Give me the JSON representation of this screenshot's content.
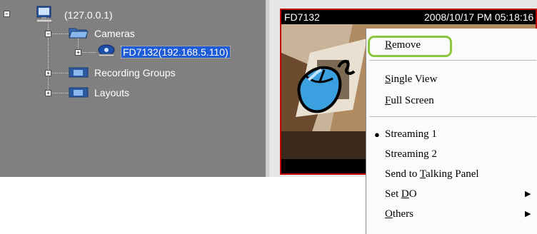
{
  "tree": {
    "root_label": "(127.0.0.1)",
    "cameras_label": "Cameras",
    "camera_item_label": "FD7132(192.168.5.110)",
    "recording_groups_label": "Recording Groups",
    "layouts_label": "Layouts"
  },
  "video": {
    "camera_name": "FD7132",
    "timestamp": "2008/10/17 PM 05:18:16"
  },
  "context_menu": {
    "items": [
      {
        "label": "Remove",
        "mnemonic": "R",
        "highlighted": true
      },
      {
        "label": "Single View",
        "mnemonic": "S"
      },
      {
        "label": "Full Screen",
        "mnemonic": "F"
      },
      {
        "label": "Streaming 1",
        "checked": true
      },
      {
        "label": "Streaming 2"
      },
      {
        "label": "Send to Talking Panel",
        "mnemonic": "T"
      },
      {
        "label": "Set DO",
        "mnemonic": "D",
        "submenu": true
      },
      {
        "label": "Others",
        "mnemonic": "O",
        "submenu": true
      }
    ],
    "highlight_color": "#8cc63f"
  },
  "colors": {
    "tree_background": "#808080",
    "selection": "#1e5bd6",
    "video_border": "#c00000",
    "mouse_icon": "#3aa0e0"
  }
}
